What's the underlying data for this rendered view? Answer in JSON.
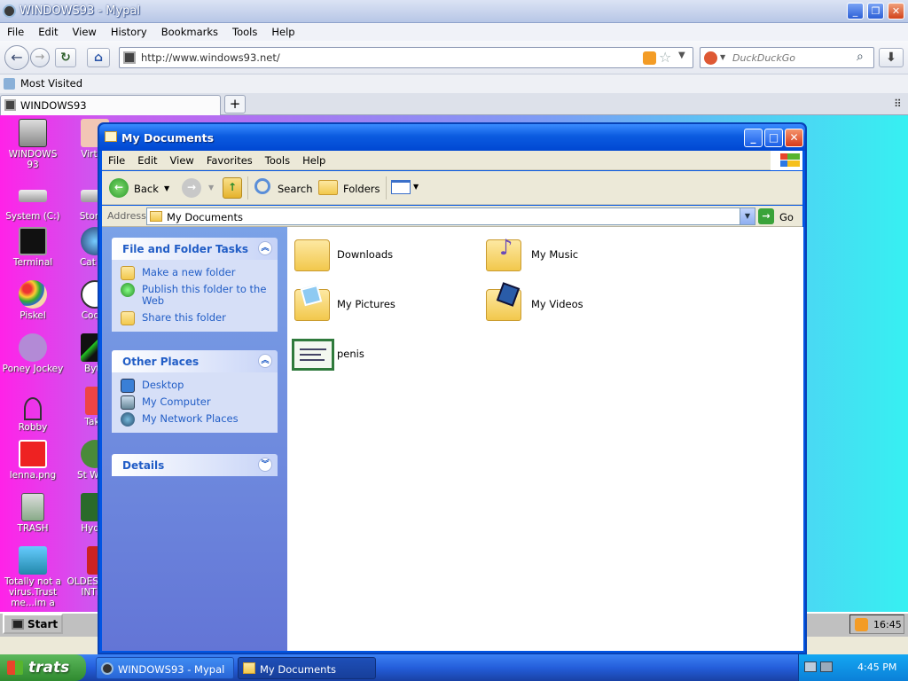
{
  "browser": {
    "title": "WINDOWS93 - Mypal",
    "menu": [
      "File",
      "Edit",
      "View",
      "History",
      "Bookmarks",
      "Tools",
      "Help"
    ],
    "url": "http://www.windows93.net/",
    "search_placeholder": "DuckDuckGo",
    "bookmarks": [
      "Most Visited"
    ],
    "tabs": [
      {
        "label": "WINDOWS93"
      }
    ]
  },
  "desktop": {
    "icons_col1": [
      "WINDOWS 93",
      "System (C:)",
      "Terminal",
      "Piskel",
      "Poney Jockey",
      "Robby",
      "lenna.png",
      "TRASH",
      "Totally not a virus.Trust me...im a"
    ],
    "icons_col2": [
      "Virtua",
      "Storag",
      "Cat Ex",
      "Codef",
      "Byte",
      "Take",
      "St Wars",
      "Hydra",
      "OLDES OF T INTER"
    ]
  },
  "w93taskbar": {
    "start": "Start",
    "clock": "16:45"
  },
  "explorer": {
    "title": "My Documents",
    "menu": [
      "File",
      "Edit",
      "View",
      "Favorites",
      "Tools",
      "Help"
    ],
    "toolbar": {
      "back": "Back",
      "search": "Search",
      "folders": "Folders"
    },
    "address_label": "Address",
    "address_value": "My Documents",
    "go_label": "Go",
    "panels": [
      {
        "title": "File and Folder Tasks",
        "items": [
          "Make a new folder",
          "Publish this folder to the Web",
          "Share this folder"
        ]
      },
      {
        "title": "Other Places",
        "items": [
          "Desktop",
          "My Computer",
          "My Network Places"
        ]
      },
      {
        "title": "Details",
        "items": []
      }
    ],
    "files": [
      {
        "name": "Downloads"
      },
      {
        "name": "My Music"
      },
      {
        "name": "My Pictures"
      },
      {
        "name": "My Videos"
      },
      {
        "name": "penis"
      }
    ]
  },
  "xptaskbar": {
    "start": "trats",
    "tasks": [
      "WINDOWS93 - Mypal",
      "My Documents"
    ],
    "clock": "4:45 PM"
  }
}
